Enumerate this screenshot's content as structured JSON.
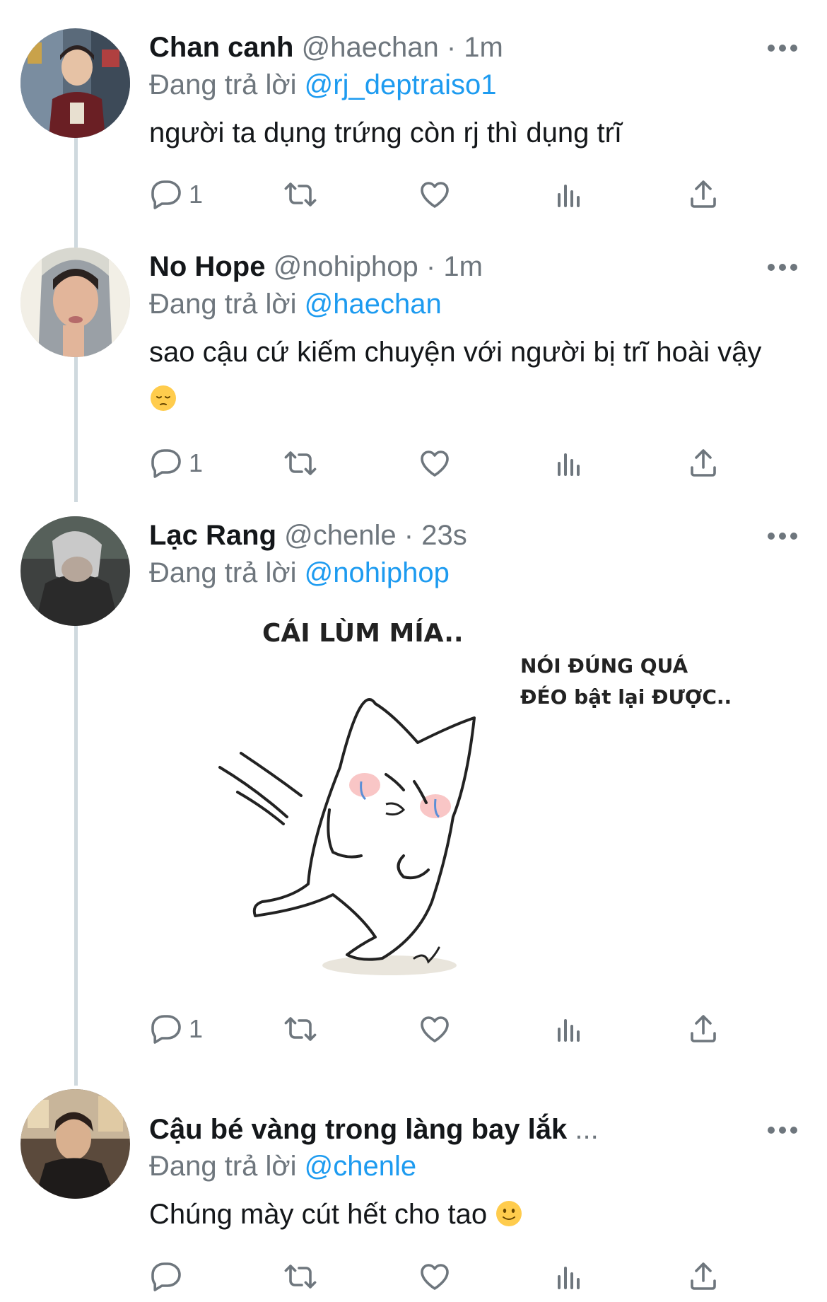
{
  "reply_prefix": "Đang trả lời",
  "tweets": [
    {
      "name": "Chan canh",
      "handle": "@haechan",
      "dot": "·",
      "time": "1m",
      "reply_to": "@rj_deptraiso1",
      "text": "người ta dụng trứng còn rj thì dụng trĩ",
      "emoji": "",
      "reply_count": "1"
    },
    {
      "name": "No Hope",
      "handle": "@nohiphop",
      "dot": "·",
      "time": "1m",
      "reply_to": "@haechan",
      "text": "sao cậu cứ kiếm chuyện với người bị trĩ hoài vậy",
      "emoji": "pensive-face-emoji",
      "reply_count": "1"
    },
    {
      "name": "Lạc Rang",
      "handle": "@chenle",
      "dot": "·",
      "time": "23s",
      "reply_to": "@nohiphop",
      "text": "",
      "reply_count": "1",
      "image": {
        "caption_top": "CÁI LÙM MÍA..",
        "caption_right_1": "NÓI ĐÚNG QUÁ",
        "caption_right_2": "ĐÉO bật lại ĐƯỢC.."
      }
    },
    {
      "name": "Cậu bé vàng trong làng bay lắk",
      "ellipsis": "...",
      "time": "",
      "reply_to": "@chenle",
      "text": "Chúng mày cút hết cho tao",
      "emoji": "slightly-smiling-face-emoji",
      "reply_count": ""
    }
  ],
  "icons": {
    "reply": "reply-bubble-icon",
    "retweet": "retweet-icon",
    "like": "heart-icon",
    "stats": "analytics-icon",
    "share": "share-icon",
    "more": "more-dots-icon"
  },
  "colors": {
    "name": "#14171a",
    "meta": "#6e767d",
    "link": "#1d9bf0",
    "thread_line": "#cfd9de"
  }
}
